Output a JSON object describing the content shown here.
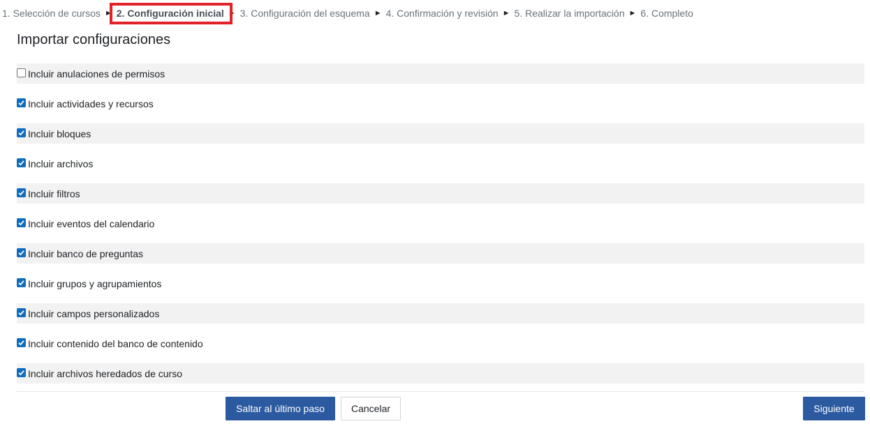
{
  "steps": [
    {
      "label": "1. Selección de cursos"
    },
    {
      "label": "2. Configuración inicial"
    },
    {
      "label": "3. Configuración del esquema"
    },
    {
      "label": "4. Confirmación y revisión"
    },
    {
      "label": "5. Realizar la importación"
    },
    {
      "label": "6. Completo"
    }
  ],
  "separator": "►",
  "section_title": "Importar configuraciones",
  "options": [
    {
      "label": "Incluir anulaciones de permisos",
      "checked": false
    },
    {
      "label": "Incluir actividades y recursos",
      "checked": true
    },
    {
      "label": "Incluir bloques",
      "checked": true
    },
    {
      "label": "Incluir archivos",
      "checked": true
    },
    {
      "label": "Incluir filtros",
      "checked": true
    },
    {
      "label": "Incluir eventos del calendario",
      "checked": true
    },
    {
      "label": "Incluir banco de preguntas",
      "checked": true
    },
    {
      "label": "Incluir grupos y agrupamientos",
      "checked": true
    },
    {
      "label": "Incluir campos personalizados",
      "checked": true
    },
    {
      "label": "Incluir contenido del banco de contenido",
      "checked": true
    },
    {
      "label": "Incluir archivos heredados de curso",
      "checked": true
    }
  ],
  "buttons": {
    "skip_label": "Saltar al último paso",
    "cancel_label": "Cancelar",
    "next_label": "Siguiente"
  },
  "colors": {
    "primary": "#2c5aa0",
    "checkbox": "#0f6cbf",
    "highlight": "#e32128"
  }
}
